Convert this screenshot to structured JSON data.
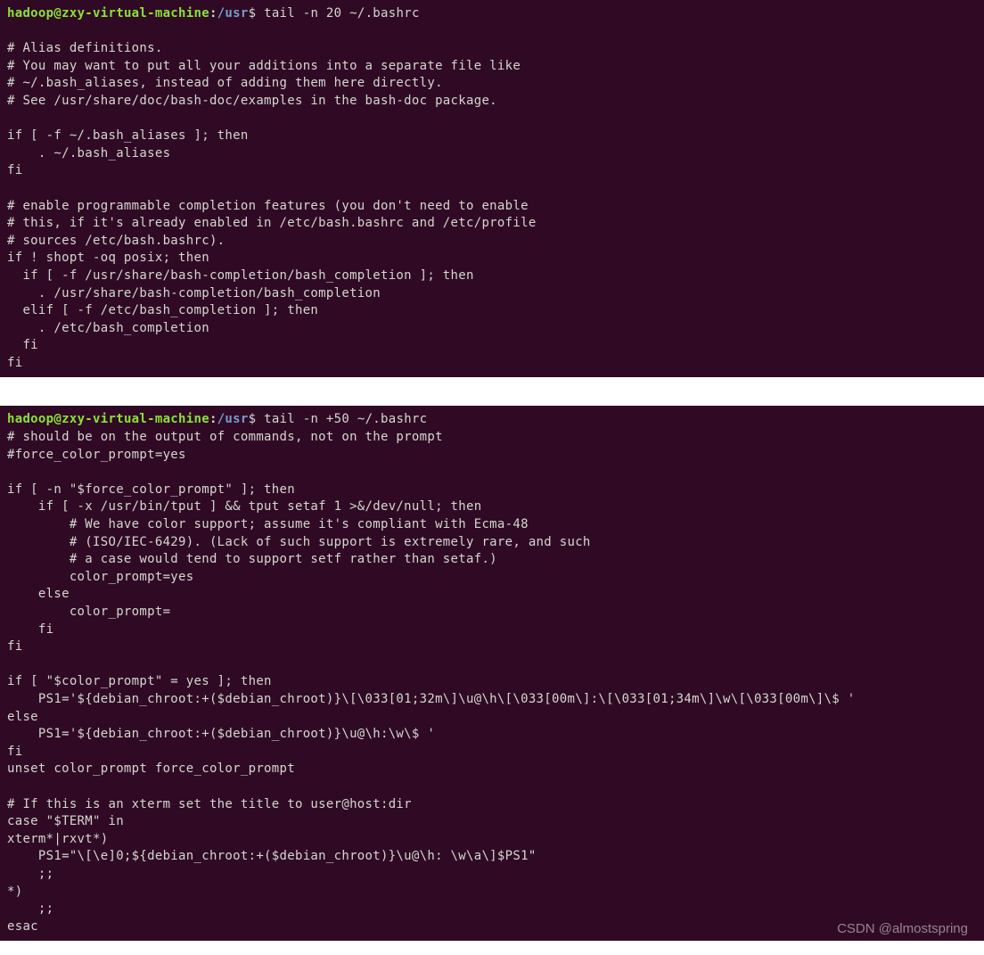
{
  "prompt": {
    "user": "hadoop",
    "at": "@",
    "host": "zxy-virtual-machine",
    "colon": ":",
    "path": "/usr",
    "dollar": "$"
  },
  "terminal1": {
    "command": "tail -n 20 ~/.bashrc",
    "output": "\n# Alias definitions.\n# You may want to put all your additions into a separate file like\n# ~/.bash_aliases, instead of adding them here directly.\n# See /usr/share/doc/bash-doc/examples in the bash-doc package.\n\nif [ -f ~/.bash_aliases ]; then\n    . ~/.bash_aliases\nfi\n\n# enable programmable completion features (you don't need to enable\n# this, if it's already enabled in /etc/bash.bashrc and /etc/profile\n# sources /etc/bash.bashrc).\nif ! shopt -oq posix; then\n  if [ -f /usr/share/bash-completion/bash_completion ]; then\n    . /usr/share/bash-completion/bash_completion\n  elif [ -f /etc/bash_completion ]; then\n    . /etc/bash_completion\n  fi\nfi"
  },
  "terminal2": {
    "command": "tail -n +50 ~/.bashrc",
    "output": "# should be on the output of commands, not on the prompt\n#force_color_prompt=yes\n\nif [ -n \"$force_color_prompt\" ]; then\n    if [ -x /usr/bin/tput ] && tput setaf 1 >&/dev/null; then\n        # We have color support; assume it's compliant with Ecma-48\n        # (ISO/IEC-6429). (Lack of such support is extremely rare, and such\n        # a case would tend to support setf rather than setaf.)\n        color_prompt=yes\n    else\n        color_prompt=\n    fi\nfi\n\nif [ \"$color_prompt\" = yes ]; then\n    PS1='${debian_chroot:+($debian_chroot)}\\[\\033[01;32m\\]\\u@\\h\\[\\033[00m\\]:\\[\\033[01;34m\\]\\w\\[\\033[00m\\]\\$ '\nelse\n    PS1='${debian_chroot:+($debian_chroot)}\\u@\\h:\\w\\$ '\nfi\nunset color_prompt force_color_prompt\n\n# If this is an xterm set the title to user@host:dir\ncase \"$TERM\" in\nxterm*|rxvt*)\n    PS1=\"\\[\\e]0;${debian_chroot:+($debian_chroot)}\\u@\\h: \\w\\a\\]$PS1\"\n    ;;\n*)\n    ;;\nesac"
  },
  "watermark": "CSDN @almostspring"
}
